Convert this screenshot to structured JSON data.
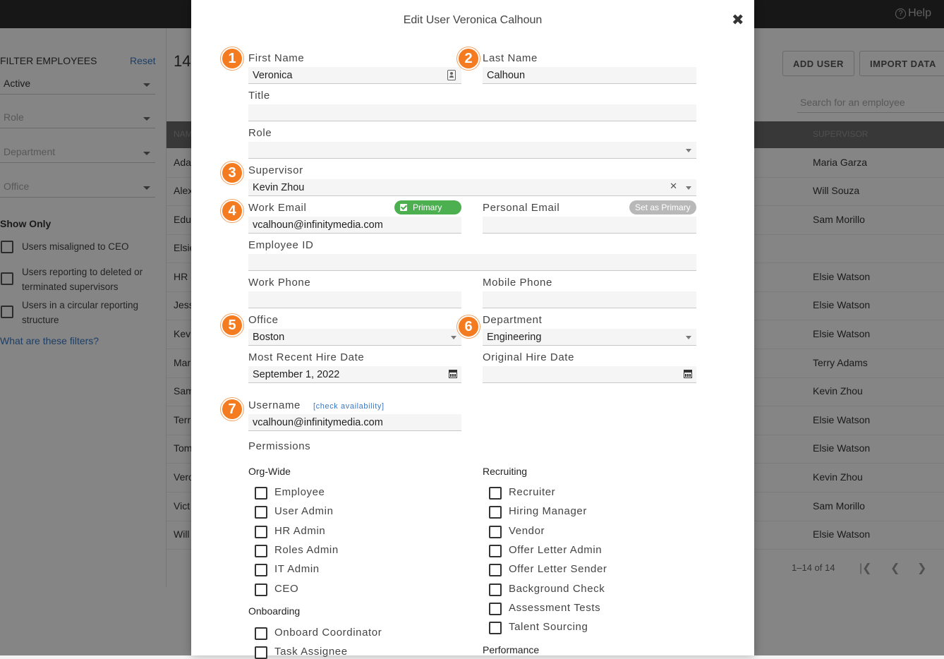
{
  "app": {
    "help_label": "Help"
  },
  "sidebar": {
    "title": "FILTER EMPLOYEES",
    "reset": "Reset",
    "filters": [
      {
        "value": "Active"
      },
      {
        "value": "Role"
      },
      {
        "value": "Department"
      },
      {
        "value": "Office"
      }
    ],
    "show_only_title": "Show Only",
    "checks": [
      "Users misaligned to CEO",
      "Users reporting to deleted or terminated supervisors",
      "Users in a circular reporting structure"
    ],
    "help_link": "What are these filters?"
  },
  "main": {
    "count": "14",
    "add_user": "ADD USER",
    "import_data": "IMPORT DATA",
    "search_placeholder": "Search for an employee",
    "col_name": "NAM",
    "col_supervisor": "SUPERVISOR",
    "rows": [
      {
        "name": "Ada",
        "supervisor": "Maria Garza"
      },
      {
        "name": "Alex",
        "supervisor": "Will Souza"
      },
      {
        "name": "Edu",
        "supervisor": "Sam Morillo"
      },
      {
        "name": "Elsie",
        "supervisor": ""
      },
      {
        "name": "HR",
        "supervisor": "Elsie Watson"
      },
      {
        "name": "Jess",
        "supervisor": "Elsie Watson"
      },
      {
        "name": "Kev",
        "supervisor": "Elsie Watson"
      },
      {
        "name": "Mar",
        "supervisor": "Terry Adams"
      },
      {
        "name": "Sam",
        "supervisor": "Kevin Zhou"
      },
      {
        "name": "Terr",
        "supervisor": "Elsie Watson"
      },
      {
        "name": "Tom",
        "supervisor": "Elsie Watson"
      },
      {
        "name": "Vero",
        "supervisor": "Kevin Zhou"
      },
      {
        "name": "Vict",
        "supervisor": "Sam Morillo"
      },
      {
        "name": "Will",
        "supervisor": "Elsie Watson"
      }
    ],
    "pager": "1–14 of 14"
  },
  "modal": {
    "title": "Edit User Veronica Calhoun",
    "badges": [
      "1",
      "2",
      "3",
      "4",
      "5",
      "6",
      "7"
    ],
    "first_name": {
      "label": "First Name",
      "value": "Veronica"
    },
    "last_name": {
      "label": "Last Name",
      "value": "Calhoun"
    },
    "title_field": {
      "label": "Title",
      "value": ""
    },
    "role": {
      "label": "Role",
      "value": ""
    },
    "supervisor": {
      "label": "Supervisor",
      "value": "Kevin Zhou"
    },
    "work_email": {
      "label": "Work Email",
      "value": "vcalhoun@infinitymedia.com",
      "pill": "Primary"
    },
    "personal_email": {
      "label": "Personal Email",
      "value": "",
      "pill": "Set as Primary"
    },
    "employee_id": {
      "label": "Employee ID",
      "value": ""
    },
    "work_phone": {
      "label": "Work Phone",
      "value": ""
    },
    "mobile_phone": {
      "label": "Mobile Phone",
      "value": ""
    },
    "office": {
      "label": "Office",
      "value": "Boston"
    },
    "department": {
      "label": "Department",
      "value": "Engineering"
    },
    "recent_hire": {
      "label": "Most Recent Hire Date",
      "value": "September 1, 2022"
    },
    "original_hire": {
      "label": "Original Hire Date",
      "value": ""
    },
    "username": {
      "label": "Username",
      "check": "[check availability]",
      "value": "vcalhoun@infinitymedia.com"
    },
    "permissions_label": "Permissions",
    "org_wide": {
      "title": "Org-Wide",
      "items": [
        "Employee",
        "User Admin",
        "HR Admin",
        "Roles Admin",
        "IT Admin",
        "CEO"
      ]
    },
    "onboarding": {
      "title": "Onboarding",
      "items": [
        "Onboard Coordinator",
        "Task Assignee"
      ]
    },
    "recruiting": {
      "title": "Recruiting",
      "items": [
        "Recruiter",
        "Hiring Manager",
        "Vendor",
        "Offer Letter Admin",
        "Offer Letter Sender",
        "Background Check",
        "Assessment Tests",
        "Talent Sourcing"
      ]
    },
    "performance": {
      "title": "Performance"
    }
  }
}
